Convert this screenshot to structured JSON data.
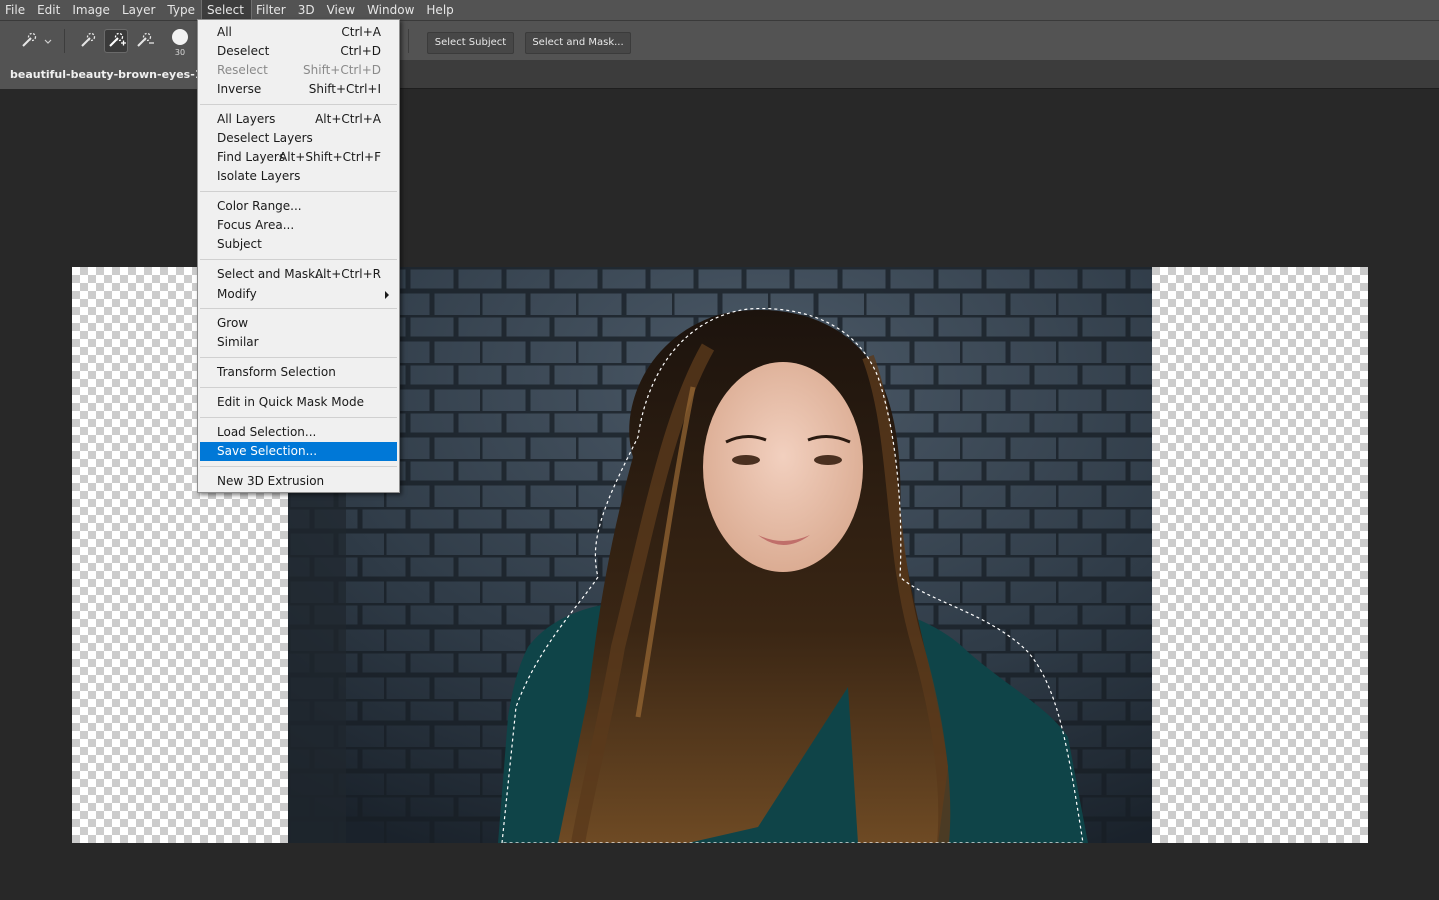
{
  "menubar": {
    "items": [
      "File",
      "Edit",
      "Image",
      "Layer",
      "Type",
      "Select",
      "Filter",
      "3D",
      "View",
      "Window",
      "Help"
    ],
    "active": "Select"
  },
  "options": {
    "brush_size": "30",
    "select_subject_label": "Select Subject",
    "select_and_mask_label": "Select and Mask..."
  },
  "document": {
    "tab_title": "beautiful-beauty-brown-eyes-10650"
  },
  "select_menu": {
    "all": {
      "label": "All",
      "shortcut": "Ctrl+A"
    },
    "deselect": {
      "label": "Deselect",
      "shortcut": "Ctrl+D"
    },
    "reselect": {
      "label": "Reselect",
      "shortcut": "Shift+Ctrl+D"
    },
    "inverse": {
      "label": "Inverse",
      "shortcut": "Shift+Ctrl+I"
    },
    "all_layers": {
      "label": "All Layers",
      "shortcut": "Alt+Ctrl+A"
    },
    "deselect_layers": {
      "label": "Deselect Layers"
    },
    "find_layers": {
      "label": "Find Layers",
      "shortcut": "Alt+Shift+Ctrl+F"
    },
    "isolate_layers": {
      "label": "Isolate Layers"
    },
    "color_range": {
      "label": "Color Range..."
    },
    "focus_area": {
      "label": "Focus Area..."
    },
    "subject": {
      "label": "Subject"
    },
    "select_and_mask": {
      "label": "Select and Mask...",
      "shortcut": "Alt+Ctrl+R"
    },
    "modify": {
      "label": "Modify"
    },
    "grow": {
      "label": "Grow"
    },
    "similar": {
      "label": "Similar"
    },
    "transform_selection": {
      "label": "Transform Selection"
    },
    "quick_mask": {
      "label": "Edit in Quick Mask Mode"
    },
    "load_selection": {
      "label": "Load Selection..."
    },
    "save_selection": {
      "label": "Save Selection..."
    },
    "new_3d_extrusion": {
      "label": "New 3D Extrusion"
    }
  },
  "colors": {
    "menubar_bg": "#535353",
    "workspace_bg": "#282828",
    "menu_highlight": "#0078d7"
  }
}
